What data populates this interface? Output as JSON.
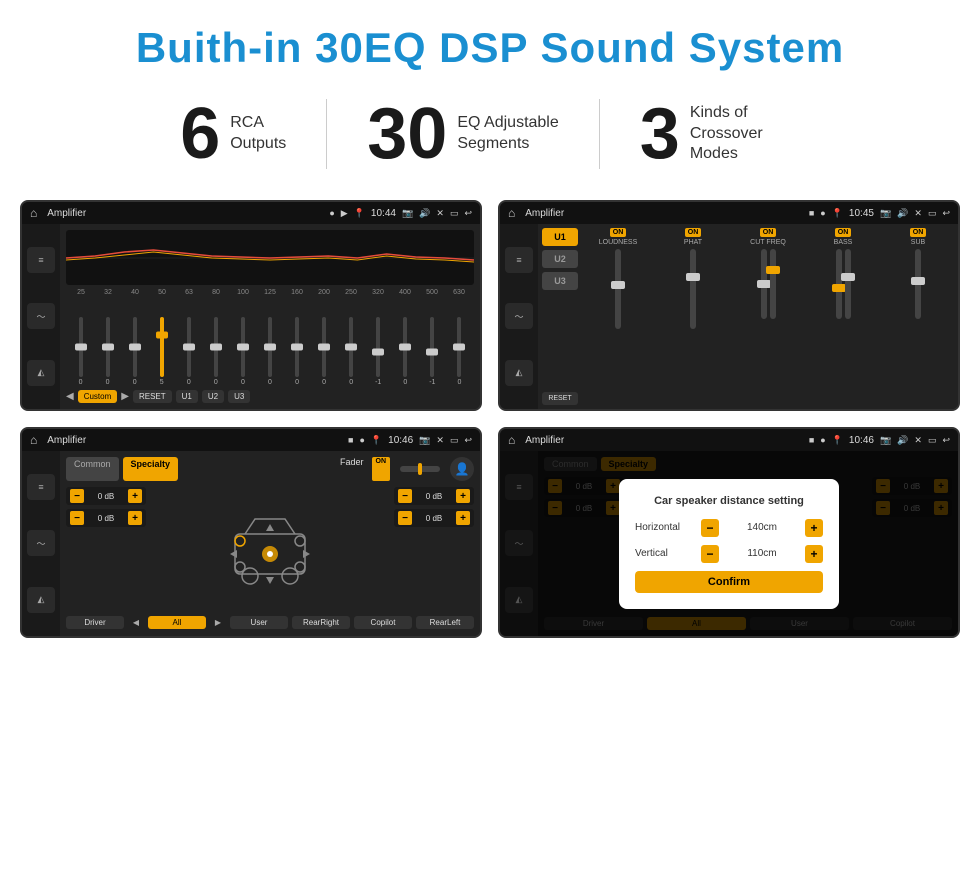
{
  "header": {
    "title": "Buith-in 30EQ DSP Sound System"
  },
  "stats": [
    {
      "number": "6",
      "line1": "RCA",
      "line2": "Outputs"
    },
    {
      "number": "30",
      "line1": "EQ Adjustable",
      "line2": "Segments"
    },
    {
      "number": "3",
      "line1": "Kinds of",
      "line2": "Crossover Modes"
    }
  ],
  "screens": {
    "screen1": {
      "status": {
        "app": "Amplifier",
        "time": "10:44"
      },
      "eq_labels": [
        "25",
        "32",
        "40",
        "50",
        "63",
        "80",
        "100",
        "125",
        "160",
        "200",
        "250",
        "320",
        "400",
        "500",
        "630"
      ],
      "eq_values": [
        "0",
        "0",
        "0",
        "5",
        "0",
        "0",
        "0",
        "0",
        "0",
        "0",
        "0",
        "-1",
        "0",
        "-1"
      ],
      "buttons": [
        "Custom",
        "RESET",
        "U1",
        "U2",
        "U3"
      ]
    },
    "screen2": {
      "status": {
        "app": "Amplifier",
        "time": "10:45"
      },
      "u_buttons": [
        "U1",
        "U2",
        "U3"
      ],
      "channels": [
        "LOUDNESS",
        "PHAT",
        "CUT FREQ",
        "BASS",
        "SUB"
      ]
    },
    "screen3": {
      "status": {
        "app": "Amplifier",
        "time": "10:46"
      },
      "tabs": [
        "Common",
        "Specialty"
      ],
      "fader_label": "Fader",
      "fader_on": "ON",
      "db_values": [
        "0 dB",
        "0 dB",
        "0 dB",
        "0 dB"
      ],
      "bottom_buttons": [
        "Driver",
        "All",
        "User",
        "RearRight",
        "Copilot",
        "RearLeft"
      ]
    },
    "screen4": {
      "status": {
        "app": "Amplifier",
        "time": "10:46"
      },
      "dialog": {
        "title": "Car speaker distance setting",
        "horizontal_label": "Horizontal",
        "horizontal_value": "140cm",
        "vertical_label": "Vertical",
        "vertical_value": "110cm",
        "confirm_label": "Confirm"
      },
      "db_values": [
        "0 dB",
        "0 dB"
      ]
    }
  }
}
